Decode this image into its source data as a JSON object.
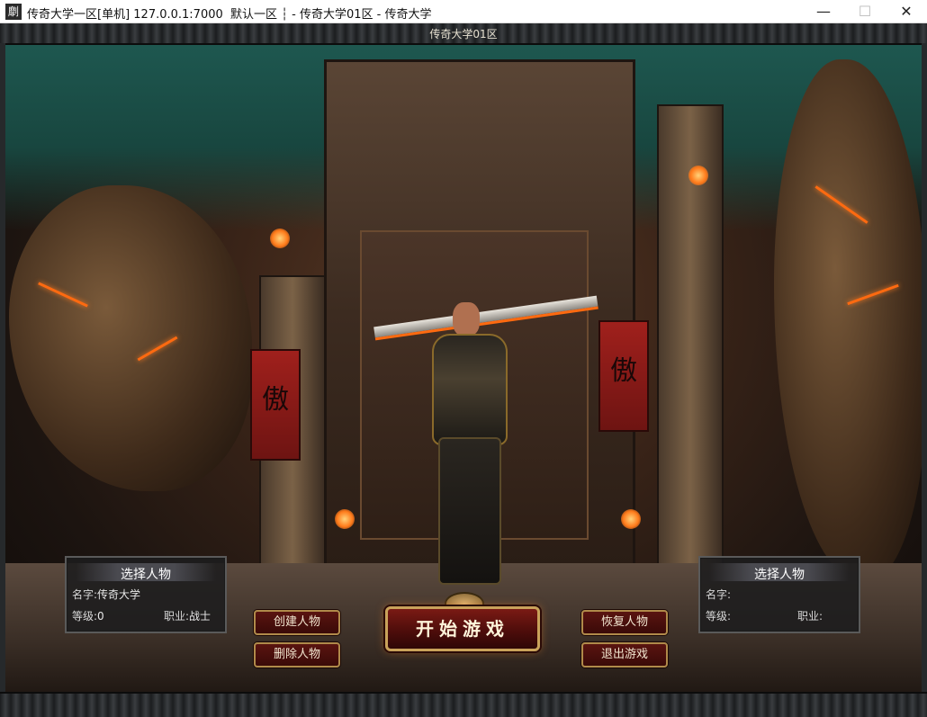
{
  "window": {
    "title": "传奇大学一区[单机] 127.0.0.1:7000  默认一区 ┆ - 传奇大学01区 - 传奇大学",
    "icon_glyph": "劘",
    "minimize_glyph": "—",
    "maximize_glyph": "☐",
    "close_glyph": "✕"
  },
  "game": {
    "server_name": "传奇大学01区",
    "banner_glyph": "傲"
  },
  "left_panel": {
    "title": "选择人物",
    "name_label": "名字:",
    "name_value": "传奇大学",
    "level_label": "等级:",
    "level_value": "0",
    "class_label": "职业:",
    "class_value": "战士"
  },
  "right_panel": {
    "title": "选择人物",
    "name_label": "名字:",
    "name_value": "",
    "level_label": "等级:",
    "level_value": "",
    "class_label": "职业:",
    "class_value": ""
  },
  "buttons": {
    "create": "创建人物",
    "delete": "删除人物",
    "start": "开始游戏",
    "restore": "恢复人物",
    "exit": "退出游戏"
  }
}
